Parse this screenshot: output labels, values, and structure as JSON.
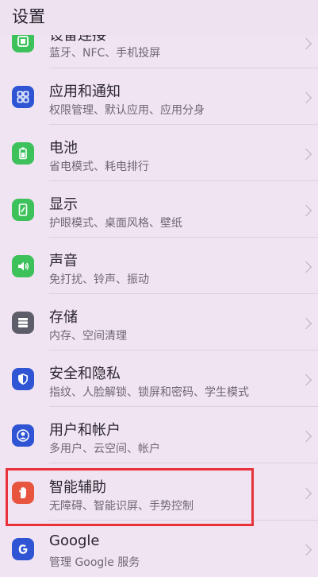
{
  "header": {
    "title": "设置"
  },
  "rows": [
    {
      "title": "设备连接",
      "subtitle": "蓝牙、NFC、手机投屏",
      "icon": "device-connect-icon",
      "color": "#3dc15b"
    },
    {
      "title": "应用和通知",
      "subtitle": "权限管理、默认应用、应用分身",
      "icon": "apps-grid-icon",
      "color": "#2f55d4"
    },
    {
      "title": "电池",
      "subtitle": "省电模式、耗电排行",
      "icon": "battery-icon",
      "color": "#3dc15b"
    },
    {
      "title": "显示",
      "subtitle": "护眼模式、桌面风格、壁纸",
      "icon": "display-icon",
      "color": "#3dc15b"
    },
    {
      "title": "声音",
      "subtitle": "免打扰、铃声、振动",
      "icon": "speaker-icon",
      "color": "#3dc15b"
    },
    {
      "title": "存储",
      "subtitle": "内存、空间清理",
      "icon": "storage-icon",
      "color": "#5d5e6a"
    },
    {
      "title": "安全和隐私",
      "subtitle": "指纹、人脸解锁、锁屏和密码、学生模式",
      "icon": "shield-icon",
      "color": "#2f55d4"
    },
    {
      "title": "用户和帐户",
      "subtitle": "多用户、云空间、帐户",
      "icon": "user-icon",
      "color": "#2f55d4"
    },
    {
      "title": "智能辅助",
      "subtitle": "无障碍、智能识屏、手势控制",
      "icon": "hand-icon",
      "color": "#e8553f"
    },
    {
      "title": "Google",
      "subtitle": "管理 Google 服务",
      "icon": "google-icon",
      "color": "#2f55d4"
    }
  ],
  "highlight_color": "#e8323a"
}
